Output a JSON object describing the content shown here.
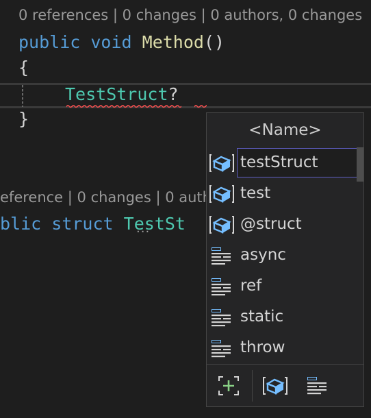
{
  "codelens": {
    "top": "0 references | 0 changes | 0 authors, 0 changes",
    "bottom": "eference | 0 changes | 0 auth"
  },
  "code": {
    "line1": {
      "kw1": "public",
      "kw2": "void",
      "name": "Method",
      "parens": "()"
    },
    "open_brace": "{",
    "line3": {
      "type": "TestStruct",
      "q": "?"
    },
    "close_brace": "}",
    "struct_line": {
      "kw1": "blic",
      "kw2": "struct",
      "type": "TestSt"
    }
  },
  "completion": {
    "header": "<Name>",
    "items": [
      {
        "label": "testStruct",
        "icon": "local-variable-icon",
        "selected": true
      },
      {
        "label": "test",
        "icon": "local-variable-icon",
        "selected": false
      },
      {
        "label": "@struct",
        "icon": "local-variable-icon",
        "selected": false
      },
      {
        "label": "async",
        "icon": "keyword-icon",
        "selected": false
      },
      {
        "label": "ref",
        "icon": "keyword-icon",
        "selected": false
      },
      {
        "label": "static",
        "icon": "keyword-icon",
        "selected": false
      },
      {
        "label": "throw",
        "icon": "keyword-icon",
        "selected": false
      }
    ],
    "footer_filters": [
      "expand-suggestions-icon",
      "local-variable-filter-icon",
      "keyword-filter-icon"
    ]
  },
  "colors": {
    "keyword": "#569cd6",
    "method": "#dcdcaa",
    "type": "#4ec9b0",
    "error_squiggle": "#f14c4c",
    "selection_outline": "#6060c8",
    "variable_icon": "#75beff",
    "add_icon": "#89d185"
  }
}
